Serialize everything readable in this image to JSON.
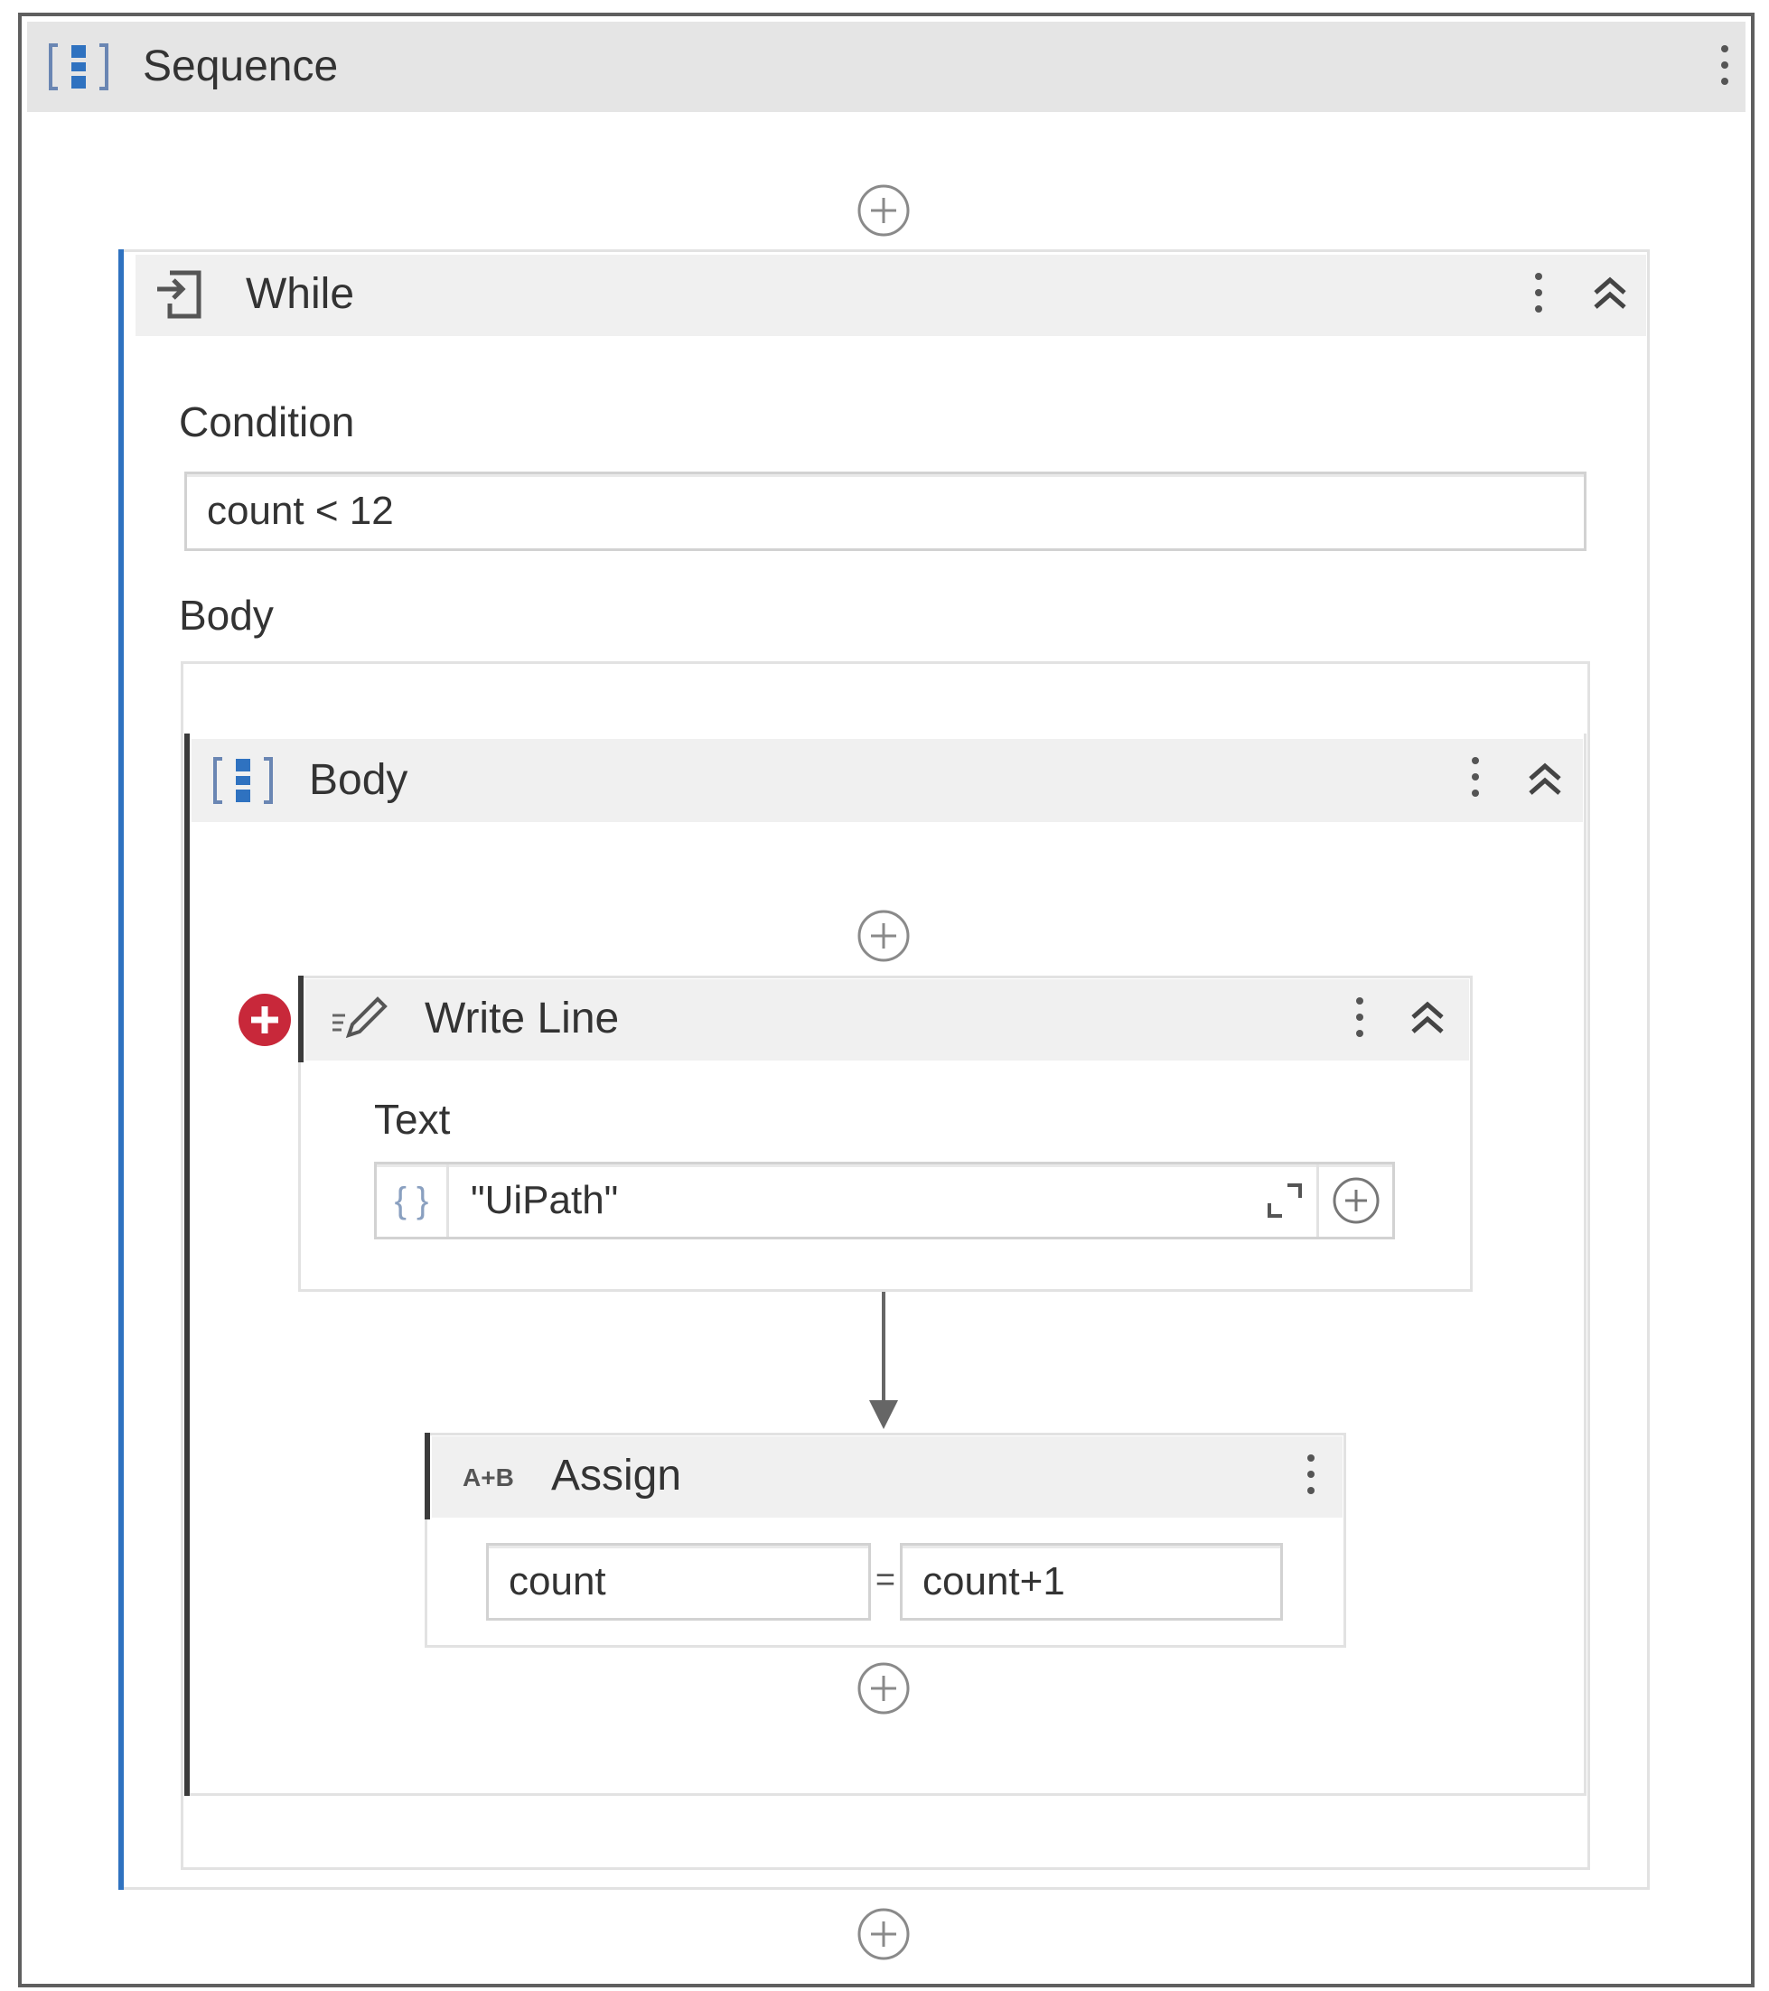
{
  "sequence": {
    "title": "Sequence",
    "icon": "sequence-icon"
  },
  "while": {
    "title": "While",
    "icon": "while-loop-icon",
    "condition_label": "Condition",
    "condition_value": "count < 12",
    "body_label": "Body"
  },
  "body": {
    "title": "Body",
    "icon": "sequence-icon"
  },
  "write_line": {
    "title": "Write Line",
    "icon": "pencil-icon",
    "text_label": "Text",
    "text_value": "\"UiPath\"",
    "error_color": "#c8283a"
  },
  "assign": {
    "title": "Assign",
    "icon": "assign-icon",
    "icon_text": "A+B",
    "to_value": "count",
    "equals": "=",
    "value": "count+1"
  },
  "colors": {
    "accent_blue": "#2f72c0",
    "dark_bar": "#3b3b3b"
  }
}
